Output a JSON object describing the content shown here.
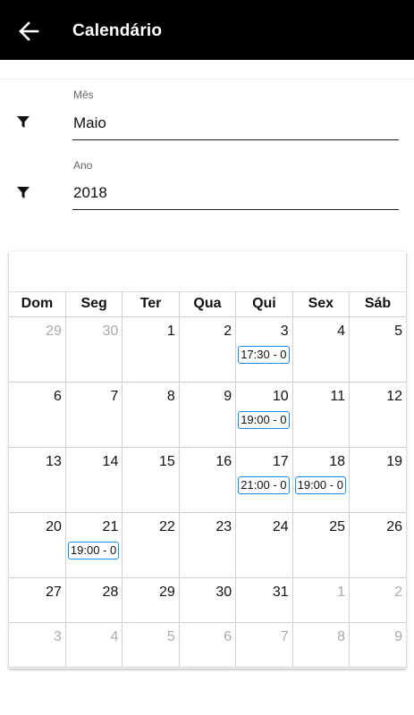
{
  "header": {
    "title": "Calendário",
    "back_icon": "arrow-left-icon"
  },
  "filters": {
    "month": {
      "label": "Mês",
      "value": "Maio",
      "icon": "filter-icon"
    },
    "year": {
      "label": "Ano",
      "value": "2018",
      "icon": "filter-icon"
    }
  },
  "calendar": {
    "weekdays": [
      "Dom",
      "Seg",
      "Ter",
      "Qua",
      "Qui",
      "Sex",
      "Sáb"
    ],
    "weeks": [
      [
        {
          "d": "29",
          "o": true
        },
        {
          "d": "30",
          "o": true
        },
        {
          "d": "1"
        },
        {
          "d": "2"
        },
        {
          "d": "3",
          "e": "17:30 - 0"
        },
        {
          "d": "4"
        },
        {
          "d": "5"
        }
      ],
      [
        {
          "d": "6"
        },
        {
          "d": "7"
        },
        {
          "d": "8"
        },
        {
          "d": "9"
        },
        {
          "d": "10",
          "e": "19:00 - 0"
        },
        {
          "d": "11"
        },
        {
          "d": "12"
        }
      ],
      [
        {
          "d": "13"
        },
        {
          "d": "14"
        },
        {
          "d": "15"
        },
        {
          "d": "16"
        },
        {
          "d": "17",
          "e": "21:00 - 0"
        },
        {
          "d": "18",
          "e": "19:00 - 0"
        },
        {
          "d": "19"
        }
      ],
      [
        {
          "d": "20"
        },
        {
          "d": "21",
          "e": "19:00 - 0"
        },
        {
          "d": "22"
        },
        {
          "d": "23"
        },
        {
          "d": "24"
        },
        {
          "d": "25"
        },
        {
          "d": "26"
        }
      ],
      [
        {
          "d": "27"
        },
        {
          "d": "28"
        },
        {
          "d": "29"
        },
        {
          "d": "30"
        },
        {
          "d": "31"
        },
        {
          "d": "1",
          "o": true
        },
        {
          "d": "2",
          "o": true
        }
      ],
      [
        {
          "d": "3",
          "o": true
        },
        {
          "d": "4",
          "o": true
        },
        {
          "d": "5",
          "o": true
        },
        {
          "d": "6",
          "o": true
        },
        {
          "d": "7",
          "o": true
        },
        {
          "d": "8",
          "o": true
        },
        {
          "d": "9",
          "o": true
        }
      ]
    ],
    "event_color": "#1e88e5"
  }
}
